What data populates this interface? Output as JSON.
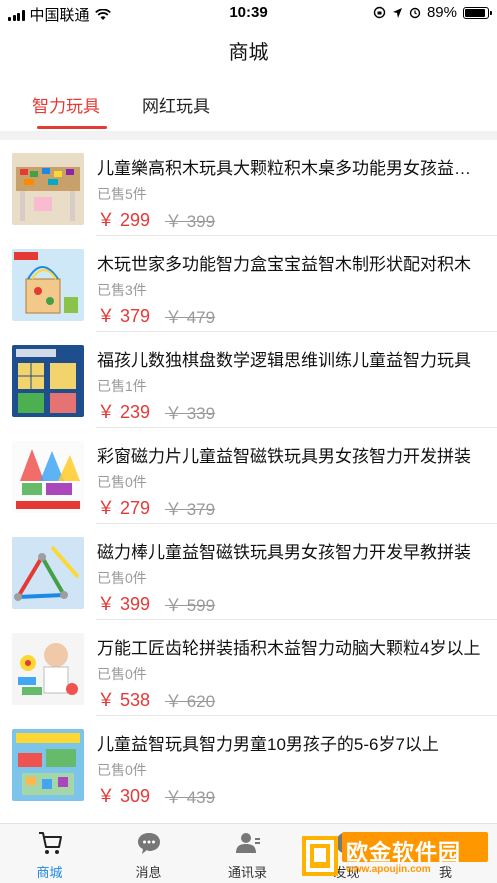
{
  "status_bar": {
    "carrier": "中国联通",
    "time": "10:39",
    "battery": "89%",
    "battery_level": 0.89
  },
  "header": {
    "title": "商城"
  },
  "tabs": [
    {
      "label": "智力玩具",
      "active": true
    },
    {
      "label": "网红玩具",
      "active": false
    }
  ],
  "products": [
    {
      "title": "儿童樂高积木玩具大颗粒积木桌多功能男女孩益智拼装",
      "sold": "已售5件",
      "price": "￥ 299",
      "original_price": "￥ 399"
    },
    {
      "title": "木玩世家多功能智力盒宝宝益智木制形状配对积木",
      "sold": "已售3件",
      "price": "￥ 379",
      "original_price": "￥ 479"
    },
    {
      "title": "福孩儿数独棋盘数学逻辑思维训练儿童益智力玩具",
      "sold": "已售1件",
      "price": "￥ 239",
      "original_price": "￥ 339"
    },
    {
      "title": "彩窗磁力片儿童益智磁铁玩具男女孩智力开发拼装",
      "sold": "已售0件",
      "price": "￥ 279",
      "original_price": "￥ 379"
    },
    {
      "title": "磁力棒儿童益智磁铁玩具男女孩智力开发早教拼装",
      "sold": "已售0件",
      "price": "￥ 399",
      "original_price": "￥ 599"
    },
    {
      "title": "万能工匠齿轮拼装插积木益智力动脑大颗粒4岁以上",
      "sold": "已售0件",
      "price": "￥ 538",
      "original_price": "￥ 620"
    },
    {
      "title": "儿童益智玩具智力男童10男孩子的5-6岁7以上",
      "sold": "已售0件",
      "price": "￥ 309",
      "original_price": "￥ 439"
    }
  ],
  "tabbar": [
    {
      "label": "商城",
      "icon": "cart-icon",
      "active": true
    },
    {
      "label": "消息",
      "icon": "chat-bubble-icon",
      "active": false
    },
    {
      "label": "通讯录",
      "icon": "contacts-icon",
      "active": false
    },
    {
      "label": "发现",
      "icon": "discover-icon",
      "active": false
    },
    {
      "label": "我",
      "icon": "person-icon",
      "active": false
    }
  ],
  "watermark": {
    "text": "欧金软件园",
    "url": "www.apoujin.com"
  },
  "colors": {
    "accent": "#e53935",
    "active_tab_blue": "#1e88e5"
  }
}
